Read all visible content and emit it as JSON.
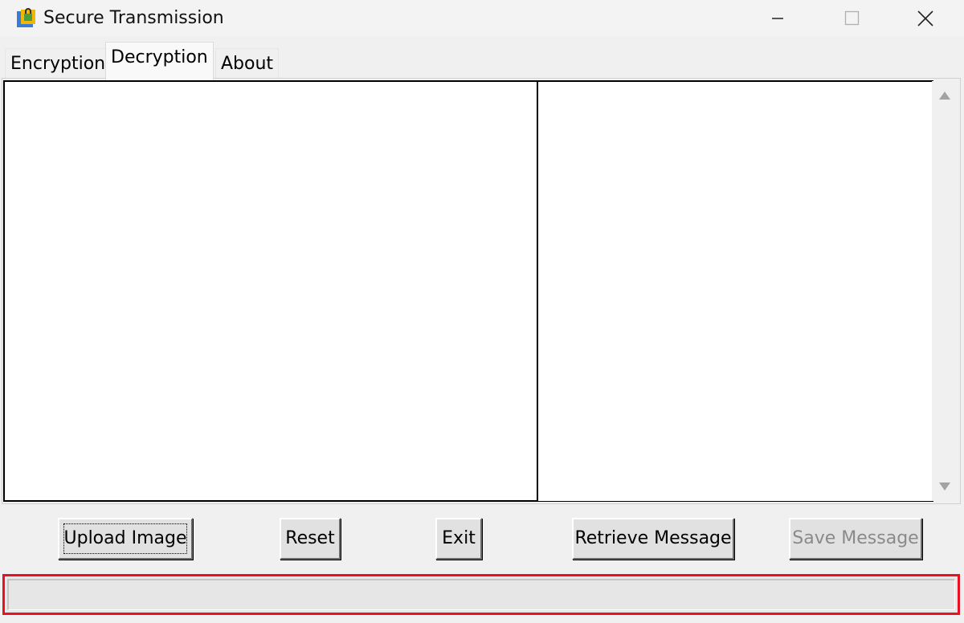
{
  "window": {
    "title": "Secure Transmission",
    "app_icon": "lock-icon",
    "controls": [
      "minimize-icon",
      "maximize-icon",
      "close-icon"
    ]
  },
  "tabs": [
    {
      "label": "Encryption",
      "selected": false
    },
    {
      "label": "Decryption",
      "selected": true
    },
    {
      "label": "About",
      "selected": false
    }
  ],
  "buttons": {
    "upload_image": "Upload Image",
    "reset": "Reset",
    "exit": "Exit",
    "retrieve_message": "Retrieve Message",
    "save_message": "Save Message"
  },
  "message_box": {
    "value": ""
  },
  "status_bar": {
    "text": "",
    "highlight_color": "#e81123"
  }
}
